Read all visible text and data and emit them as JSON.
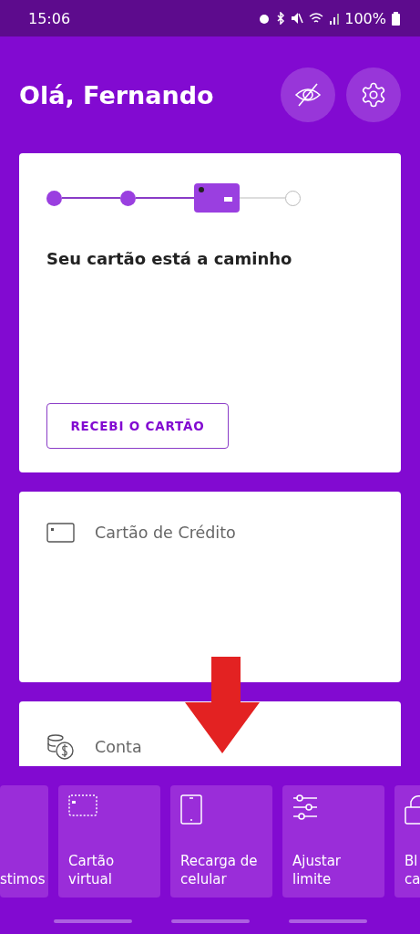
{
  "status_bar": {
    "time": "15:06",
    "battery": "100%"
  },
  "header": {
    "greeting": "Olá, Fernando"
  },
  "delivery_card": {
    "steps": [
      {
        "completed": true,
        "current": false
      },
      {
        "completed": true,
        "current": false
      },
      {
        "completed": false,
        "current": true
      },
      {
        "completed": false,
        "current": false
      }
    ],
    "title": "Seu cartão está a caminho",
    "button": "RECEBI O CARTÃO"
  },
  "sections": [
    {
      "kind": "card",
      "title": "Cartão de Crédito"
    },
    {
      "kind": "account",
      "title": "Conta"
    }
  ],
  "shortcuts": [
    {
      "kind": "cut_left",
      "lines": [
        "stimos"
      ]
    },
    {
      "kind": "virtual_card",
      "lines": [
        "Cartão",
        "virtual"
      ]
    },
    {
      "kind": "phone",
      "lines": [
        "Recarga de",
        "celular"
      ]
    },
    {
      "kind": "sliders",
      "lines": [
        "Ajustar",
        "limite"
      ]
    },
    {
      "kind": "lock",
      "lines": [
        "Bl",
        "ca"
      ]
    }
  ],
  "page_indicators": [
    {
      "selected": false
    },
    {
      "selected": false
    },
    {
      "selected": false
    }
  ]
}
